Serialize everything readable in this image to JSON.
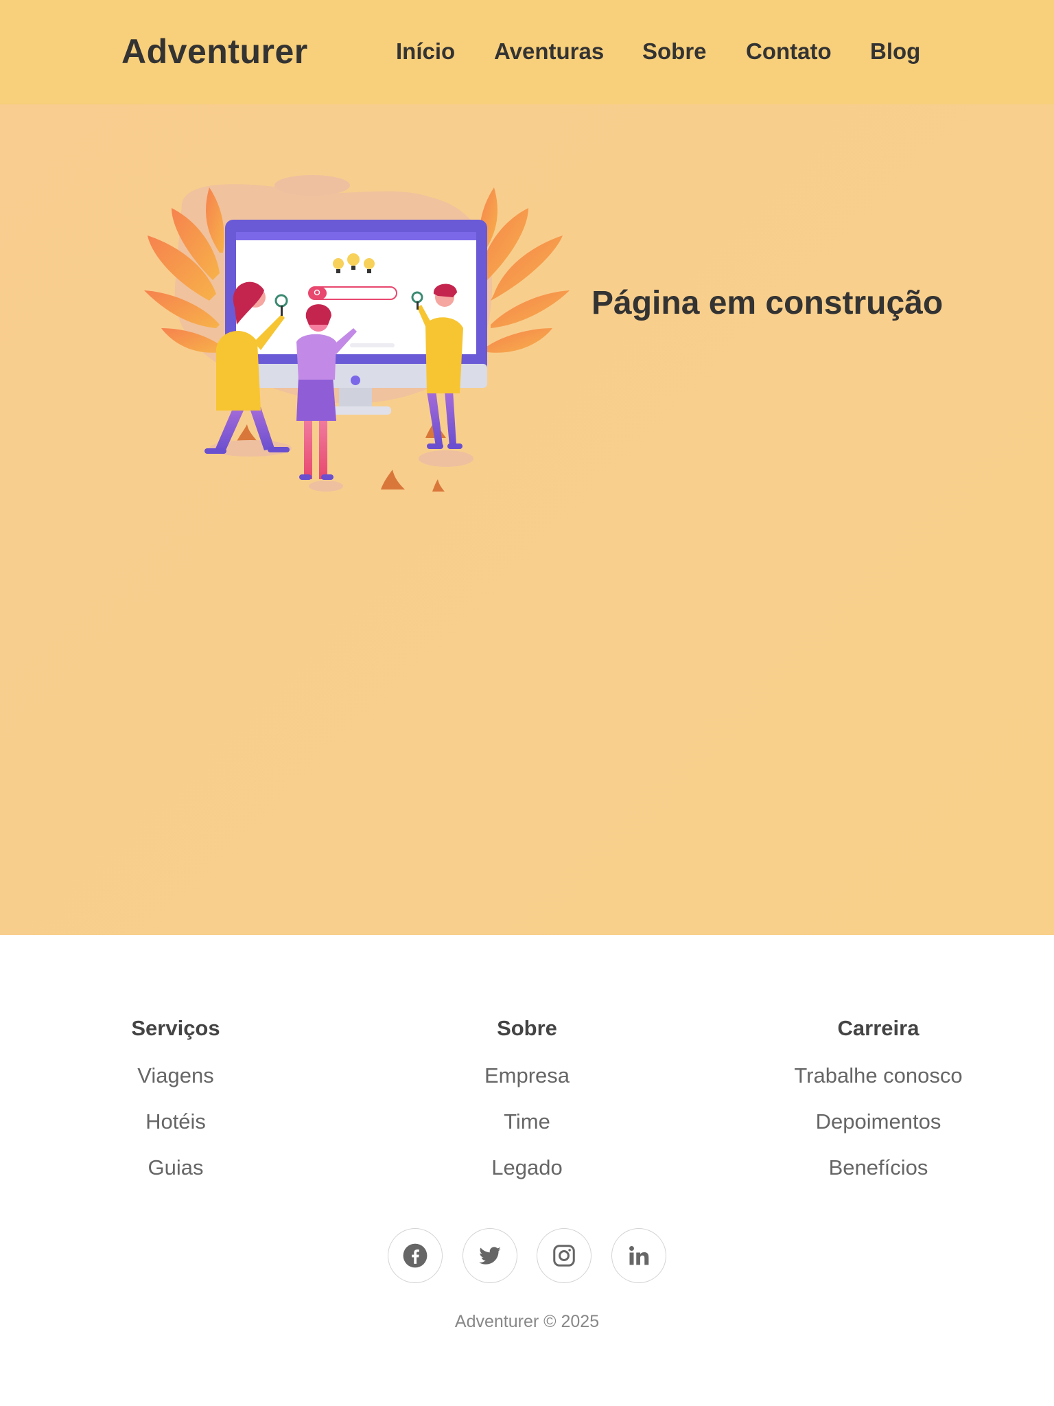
{
  "header": {
    "logo": "Adventurer",
    "nav": [
      {
        "label": "Início"
      },
      {
        "label": "Aventuras"
      },
      {
        "label": "Sobre"
      },
      {
        "label": "Contato"
      },
      {
        "label": "Blog"
      }
    ]
  },
  "hero": {
    "title": "Página em construção",
    "illustration_icon": "under-construction-illustration"
  },
  "footer": {
    "columns": [
      {
        "title": "Serviços",
        "links": [
          "Viagens",
          "Hotéis",
          "Guias"
        ]
      },
      {
        "title": "Sobre",
        "links": [
          "Empresa",
          "Time",
          "Legado"
        ]
      },
      {
        "title": "Carreira",
        "links": [
          "Trabalhe conosco",
          "Depoimentos",
          "Benefícios"
        ]
      }
    ],
    "social": [
      {
        "icon": "facebook-icon"
      },
      {
        "icon": "twitter-icon"
      },
      {
        "icon": "instagram-icon"
      },
      {
        "icon": "linkedin-icon"
      }
    ],
    "copyright": "Adventurer © 2025"
  },
  "colors": {
    "header_bg": "#f8cf7a",
    "hero_bg": "#f8cd8f",
    "text": "#333333",
    "footer_link": "#666666",
    "accent_purple": "#6a5acd"
  }
}
